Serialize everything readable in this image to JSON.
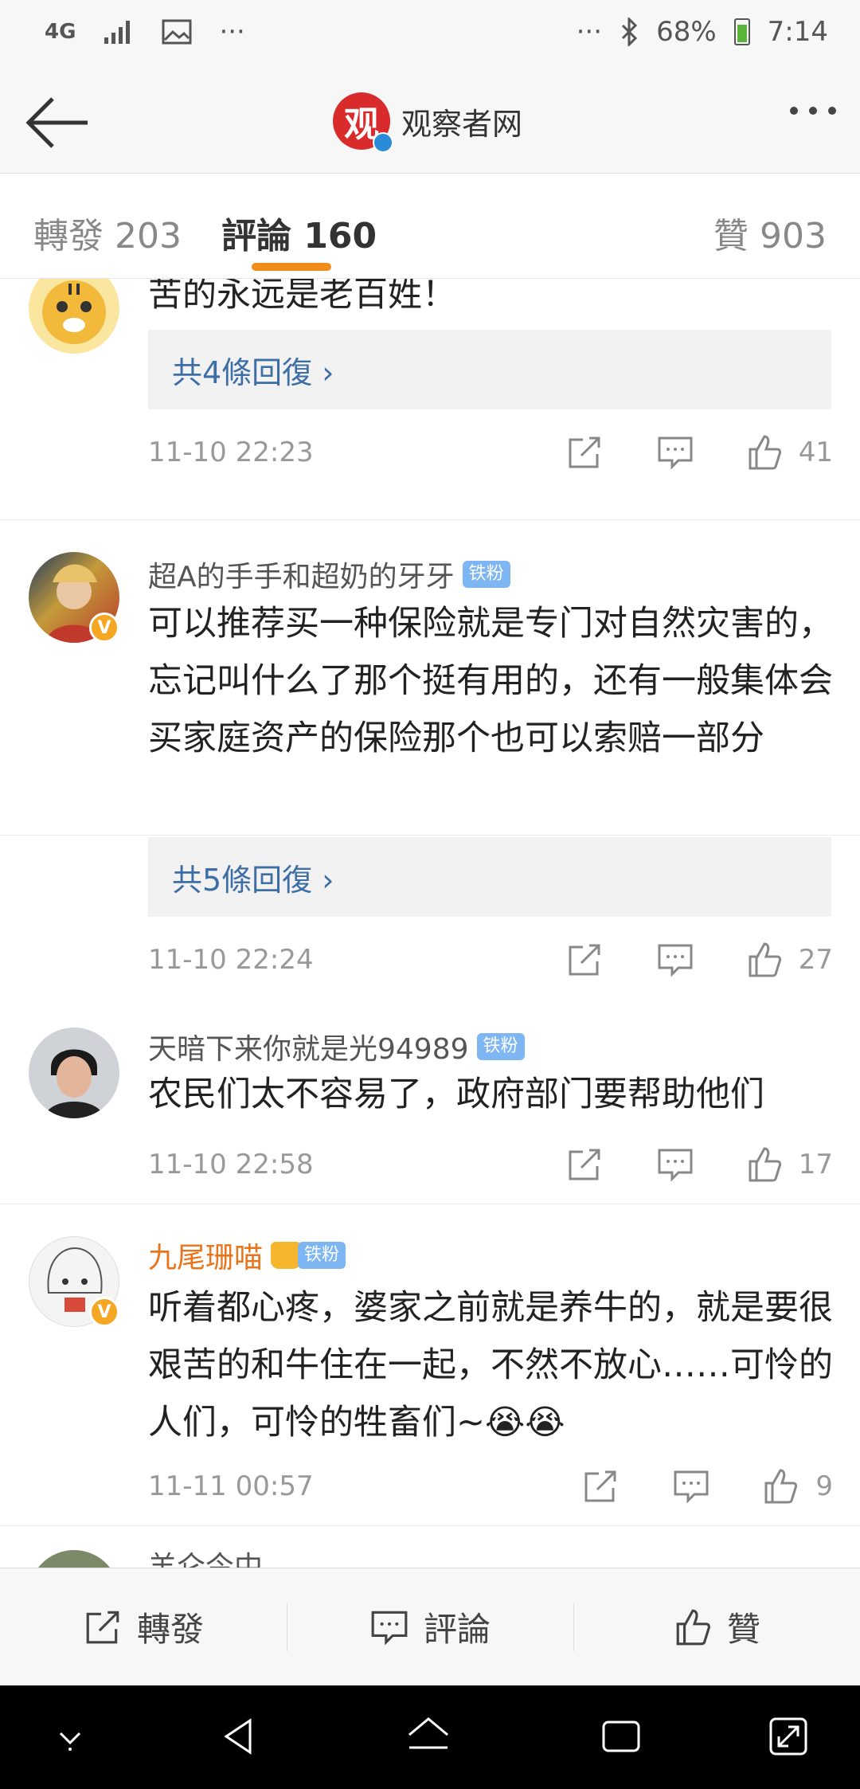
{
  "status_bar": {
    "network": "4G",
    "more_left": "···",
    "more_right": "···",
    "battery": "68%",
    "time": "7:14"
  },
  "header": {
    "logo_char": "观",
    "title": "观察者网"
  },
  "tabs": {
    "repost": "轉發 203",
    "comment": "評論 160",
    "like": "贊 903"
  },
  "comments": [
    {
      "username": "",
      "text": "苦的永远是老百姓！",
      "replies": "共4條回復 ›",
      "time": "11-10 22:23",
      "likes": "41"
    },
    {
      "username": "超A的手手和超奶的牙牙",
      "badge": "铁粉",
      "text": "可以推荐买一种保险就是专门对自然灾害的，忘记叫什么了那个挺有用的，还有一般集体会买家庭资产的保险那个也可以索赔一部分",
      "replies": "共5條回復 ›",
      "time": "11-10 22:24",
      "likes": "27"
    },
    {
      "username": "天暗下来你就是光94989",
      "badge": "铁粉",
      "text": "农民们太不容易了，政府部门要帮助他们",
      "time": "11-10 22:58",
      "likes": "17"
    },
    {
      "username": "九尾珊喵",
      "badge": "铁粉",
      "text": "听着都心疼，婆家之前就是养牛的，就是要很艰苦的和牛住在一起，不然不放心……可怜的人们，可怜的牲畜们~😭😭",
      "time": "11-11 00:57",
      "likes": "9"
    },
    {
      "username": "羊仑今中"
    }
  ],
  "action_bar": {
    "repost": "轉發",
    "comment": "評論",
    "like": "贊"
  },
  "colors": {
    "accent": "#f28c18",
    "link": "#3d6ea6",
    "vip_name": "#e8741c",
    "badge": "#7eb6f3"
  }
}
